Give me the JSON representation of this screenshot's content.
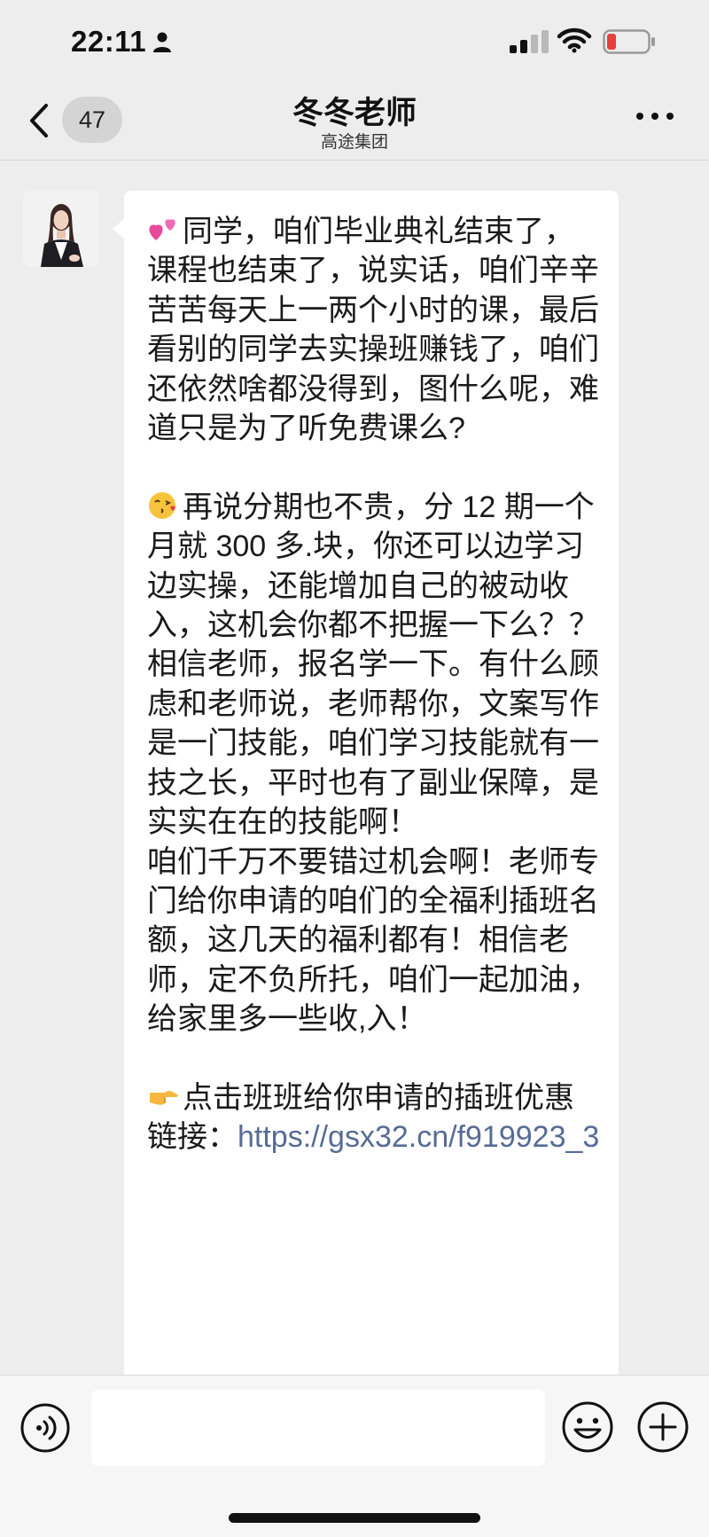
{
  "status_bar": {
    "time": "22:11",
    "icons": [
      "person-icon",
      "signal-icon",
      "wifi-icon",
      "battery-low-icon"
    ]
  },
  "nav": {
    "back_icon": "chevron-left-icon",
    "unread_count": "47",
    "title": "冬冬老师",
    "subtitle": "高途集团",
    "more_icon": "more-dots-icon"
  },
  "message": {
    "sender_avatar": "teacher-avatar",
    "para1_emoji": "two-hearts-emoji",
    "para1": "同学，咱们毕业典礼结束了，课程也结束了，说实话，咱们辛辛苦苦每天上一两个小时的课，最后看别的同学去实操班赚钱了，咱们还依然啥都没得到，图什么呢，难道只是为了听免费课么?",
    "para2_emoji": "face-blowing-kiss-emoji",
    "para2": "再说分期也不贵，分 12 期一个月就 300 多.块，你还可以边学习边实操，还能增加自己的被动收入，这机会你都不把握一下么？？\n相信老师，报名学一下。有什么顾虑和老师说，老师帮你，文案写作是一门技能，咱们学习技能就有一技之长，平时也有了副业保障，是实实在在的技能啊！\n咱们千万不要错过机会啊！老师专门给你申请的咱们的全福利插班名额，这几天的福利都有！相信老师，定不负所托，咱们一起加油，给家里多一些收,入！",
    "para3_emoji": "pointing-right-emoji",
    "para3": "点击班班给你申请的插班优惠链接：",
    "link": "https://gsx32.cn/f919923_3"
  },
  "input_bar": {
    "voice_icon": "voice-icon",
    "input_value": "",
    "emoji_icon": "emoji-icon",
    "plus_icon": "plus-icon"
  },
  "colors": {
    "background": "#ededed",
    "bubble": "#ffffff",
    "link": "#576b95",
    "battery_low": "#e5403a"
  }
}
